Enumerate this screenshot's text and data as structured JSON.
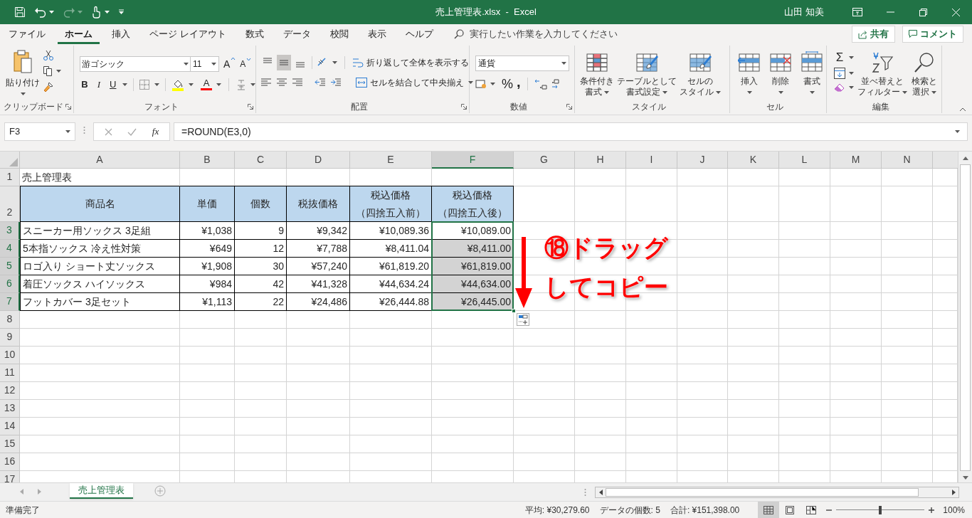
{
  "title_bar": {
    "title": "売上管理表.xlsx  -  Excel",
    "user": "山田 知美"
  },
  "menu_tabs": [
    {
      "label": "ファイル",
      "selected": false
    },
    {
      "label": "ホーム",
      "selected": true
    },
    {
      "label": "挿入",
      "selected": false
    },
    {
      "label": "ページ レイアウト",
      "selected": false
    },
    {
      "label": "数式",
      "selected": false
    },
    {
      "label": "データ",
      "selected": false
    },
    {
      "label": "校閲",
      "selected": false
    },
    {
      "label": "表示",
      "selected": false
    },
    {
      "label": "ヘルプ",
      "selected": false
    }
  ],
  "tell_me": {
    "placeholder": "実行したい作業を入力してください"
  },
  "share_button": "共有",
  "comment_button": "コメント",
  "ribbon": [
    {
      "kind": "clipboard",
      "label": "クリップボード",
      "paste": "貼り付け"
    },
    {
      "kind": "font",
      "label": "フォント",
      "font_name": "游ゴシック",
      "font_size": "11",
      "grow_font": "A",
      "shrink_font": "A",
      "style_buttons": [
        "B",
        "I",
        "U"
      ],
      "font_color": "A"
    },
    {
      "kind": "alignment",
      "label": "配置",
      "vertical_align": [
        {
          "selected": false
        },
        {
          "selected": true
        },
        {
          "selected": false
        }
      ],
      "wrap_text": "折り返して全体を表示する",
      "merge": "セルを結合して中央揃え"
    },
    {
      "kind": "number",
      "label": "数値",
      "format": "通貨",
      "percent": "%",
      "comma": ","
    },
    {
      "kind": "styles",
      "label": "スタイル",
      "buttons": [
        {
          "lines": [
            "条件付き",
            "書式"
          ]
        },
        {
          "lines": [
            "テーブルとして",
            "書式設定"
          ]
        },
        {
          "lines": [
            "セルの",
            "スタイル"
          ]
        }
      ]
    },
    {
      "kind": "cells",
      "label": "セル",
      "buttons": [
        {
          "lines": [
            "挿入"
          ]
        },
        {
          "lines": [
            "削除"
          ]
        },
        {
          "lines": [
            "書式"
          ]
        }
      ]
    },
    {
      "kind": "editing",
      "label": "編集",
      "autosum": "Σ",
      "buttons": [
        {
          "lines": [
            "並べ替えと",
            "フィルター"
          ]
        },
        {
          "lines": [
            "検索と",
            "選択"
          ]
        }
      ]
    }
  ],
  "formula_bar": {
    "name_box": "F3",
    "function_button": "fx",
    "formula": "=ROUND(E3,0)"
  },
  "sheet": {
    "columns": [
      {
        "label": "A",
        "selected": false
      },
      {
        "label": "B",
        "selected": false
      },
      {
        "label": "C",
        "selected": false
      },
      {
        "label": "D",
        "selected": false
      },
      {
        "label": "E",
        "selected": false
      },
      {
        "label": "F",
        "selected": true
      },
      {
        "label": "G",
        "selected": false
      },
      {
        "label": "H",
        "selected": false
      },
      {
        "label": "I",
        "selected": false
      },
      {
        "label": "J",
        "selected": false
      },
      {
        "label": "K",
        "selected": false
      },
      {
        "label": "L",
        "selected": false
      },
      {
        "label": "M",
        "selected": false
      },
      {
        "label": "N",
        "selected": false
      }
    ],
    "rows": [
      {
        "number": "1",
        "kind": "title",
        "selected": false,
        "cells": [
          "売上管理表"
        ]
      },
      {
        "number": "2",
        "kind": "header",
        "selected": false,
        "cells": [
          "商品名",
          "単価",
          "個数",
          "税抜価格",
          [
            "税込価格",
            "（四捨五入前）"
          ],
          [
            "税込価格",
            "（四捨五入後）"
          ]
        ]
      },
      {
        "number": "3",
        "kind": "data",
        "selected": true,
        "cells": [
          "スニーカー用ソックス 3足組",
          "¥1,038",
          "9",
          "¥9,342",
          "¥10,089.36",
          "¥10,089.00"
        ]
      },
      {
        "number": "4",
        "kind": "data",
        "selected": true,
        "cells": [
          "5本指ソックス 冷え性対策",
          "¥649",
          "12",
          "¥7,788",
          "¥8,411.04",
          "¥8,411.00"
        ]
      },
      {
        "number": "5",
        "kind": "data",
        "selected": true,
        "cells": [
          "ロゴ入り ショート丈ソックス",
          "¥1,908",
          "30",
          "¥57,240",
          "¥61,819.20",
          "¥61,819.00"
        ]
      },
      {
        "number": "6",
        "kind": "data",
        "selected": true,
        "cells": [
          "着圧ソックス ハイソックス",
          "¥984",
          "42",
          "¥41,328",
          "¥44,634.24",
          "¥44,634.00"
        ]
      },
      {
        "number": "7",
        "kind": "data",
        "selected": true,
        "cells": [
          "フットカバー 3足セット",
          "¥1,113",
          "22",
          "¥24,486",
          "¥26,444.88",
          "¥26,445.00"
        ]
      },
      {
        "number": "8",
        "kind": "empty",
        "selected": false
      },
      {
        "number": "9",
        "kind": "empty",
        "selected": false
      },
      {
        "number": "10",
        "kind": "empty",
        "selected": false
      },
      {
        "number": "11",
        "kind": "empty",
        "selected": false
      },
      {
        "number": "12",
        "kind": "empty",
        "selected": false
      },
      {
        "number": "13",
        "kind": "empty",
        "selected": false
      },
      {
        "number": "14",
        "kind": "empty",
        "selected": false
      },
      {
        "number": "15",
        "kind": "empty",
        "selected": false
      },
      {
        "number": "16",
        "kind": "empty",
        "selected": false
      },
      {
        "number": "17",
        "kind": "empty",
        "selected": false
      }
    ]
  },
  "annotation": {
    "lines": [
      "⑱ドラッグ",
      "してコピー"
    ]
  },
  "sheet_tabs": [
    {
      "label": "売上管理表",
      "selected": true
    }
  ],
  "status_bar": {
    "status": "準備完了",
    "average": "平均: ¥30,279.60",
    "count": "データの個数: 5",
    "sum": "合計: ¥151,398.00",
    "views": [
      {
        "selected": true
      },
      {
        "selected": false
      },
      {
        "selected": false
      }
    ],
    "zoom": {
      "level": 0.5
    },
    "zoom_label": "100%"
  }
}
